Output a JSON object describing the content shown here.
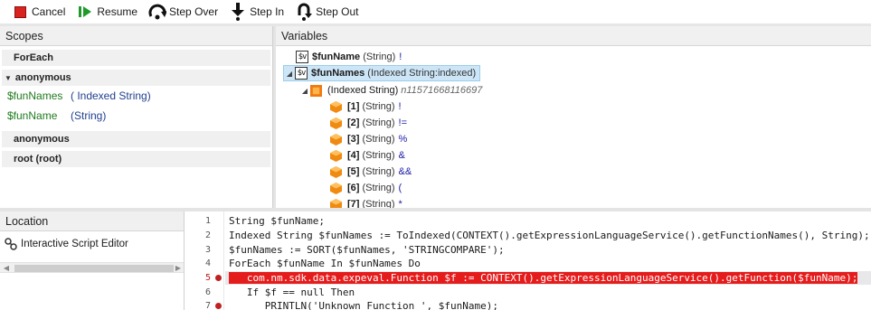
{
  "toolbar": {
    "cancel": "Cancel",
    "resume": "Resume",
    "step_over": "Step Over",
    "step_in": "Step In",
    "step_out": "Step Out"
  },
  "scopes": {
    "title": "Scopes",
    "sections": [
      {
        "label": "ForEach",
        "expanded": false
      },
      {
        "label": "anonymous",
        "expanded": true
      },
      {
        "label": "anonymous",
        "expanded": false
      },
      {
        "label": "root (root)",
        "expanded": false
      }
    ],
    "vars": [
      {
        "name": "$funNames",
        "type": "( Indexed String)"
      },
      {
        "name": "$funName",
        "type": "(String)"
      }
    ]
  },
  "variables": {
    "title": "Variables",
    "rows": [
      {
        "icon": "$v",
        "name": "$funName",
        "type": "(String)",
        "value": "!"
      },
      {
        "icon": "$v",
        "name": "$funNames",
        "type": "(Indexed String:indexed)",
        "value": ""
      },
      {
        "type": "(Indexed String)",
        "ref": "n11571668116697"
      },
      {
        "name": "[1]",
        "type": "(String)",
        "value": "!"
      },
      {
        "name": "[2]",
        "type": "(String)",
        "value": "!="
      },
      {
        "name": "[3]",
        "type": "(String)",
        "value": "%"
      },
      {
        "name": "[4]",
        "type": "(String)",
        "value": "&"
      },
      {
        "name": "[5]",
        "type": "(String)",
        "value": "&&"
      },
      {
        "name": "[6]",
        "type": "(String)",
        "value": "("
      },
      {
        "name": "[7]",
        "type": "(String)",
        "value": "*"
      }
    ]
  },
  "location": {
    "title": "Location",
    "item": "Interactive Script Editor"
  },
  "editor": {
    "lines": [
      {
        "n": "1",
        "code": "String $funName;",
        "bp": false
      },
      {
        "n": "2",
        "code": "Indexed String $funNames := ToIndexed(CONTEXT().getExpressionLanguageService().getFunctionNames(), String);",
        "bp": false
      },
      {
        "n": "3",
        "code": "$funNames := SORT($funNames, 'STRINGCOMPARE');",
        "bp": false
      },
      {
        "n": "4",
        "code": "ForEach $funName In $funNames Do",
        "bp": false
      },
      {
        "n": "5",
        "code": "   com.nm.sdk.data.expeval.Function $f := CONTEXT().getExpressionLanguageService().getFunction($funName);",
        "bp": true
      },
      {
        "n": "6",
        "code": "   If $f == null Then",
        "bp": false
      },
      {
        "n": "7",
        "code": "      PRINTLN('Unknown Function ', $funName);",
        "bp": true
      }
    ]
  },
  "colors": {
    "highlight": "#e51c1c",
    "selected_row": "#cde6f7",
    "var_name": "#1e7a1e",
    "var_type": "#1f3f8f"
  }
}
